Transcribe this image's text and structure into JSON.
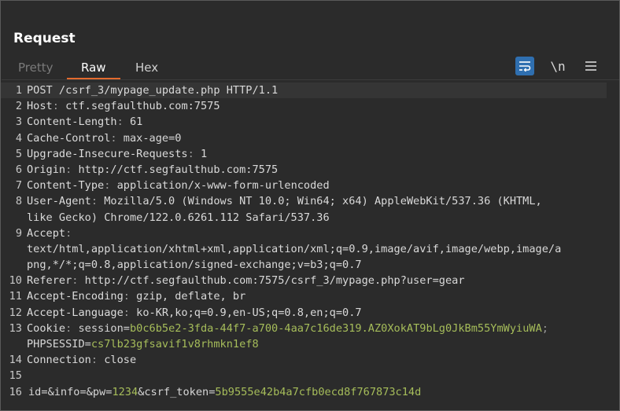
{
  "panel": {
    "title": "Request"
  },
  "tabs": [
    {
      "label": "Pretty"
    },
    {
      "label": "Raw"
    },
    {
      "label": "Hex"
    }
  ],
  "toolbar": {
    "wrap_icon": "wrap-text-icon",
    "newline_label": "\\n",
    "menu_icon": "hamburger-menu-icon",
    "wrap_color": "#2f6fb0"
  },
  "accent_color": "#e36a2e",
  "lines": [
    {
      "n": "1",
      "text": "POST /csrf_3/mypage_update.php HTTP/1.1"
    },
    {
      "n": "2",
      "key": "Host",
      "val": "ctf.segfaulthub.com:7575"
    },
    {
      "n": "3",
      "key": "Content-Length",
      "val": "61"
    },
    {
      "n": "4",
      "key": "Cache-Control",
      "val": "max-age=0"
    },
    {
      "n": "5",
      "key": "Upgrade-Insecure-Requests",
      "val": "1"
    },
    {
      "n": "6",
      "key": "Origin",
      "val": "http://ctf.segfaulthub.com:7575"
    },
    {
      "n": "7",
      "key": "Content-Type",
      "val": "application/x-www-form-urlencoded"
    },
    {
      "n": "8",
      "key": "User-Agent",
      "val": "Mozilla/5.0 (Windows NT 10.0; Win64; x64) AppleWebKit/537.36 (KHTML,",
      "cont": "like Gecko) Chrome/122.0.6261.112 Safari/537.36"
    },
    {
      "n": "9",
      "key": "Accept",
      "val": "",
      "cont": "text/html,application/xhtml+xml,application/xml;q=0.9,image/avif,image/webp,image/a",
      "cont2": "png,*/*;q=0.8,application/signed-exchange;v=b3;q=0.7"
    },
    {
      "n": "10",
      "key": "Referer",
      "val": "http://ctf.segfaulthub.com:7575/csrf_3/mypage.php?user=gear"
    },
    {
      "n": "11",
      "key": "Accept-Encoding",
      "val": "gzip, deflate, br"
    },
    {
      "n": "12",
      "key": "Accept-Language",
      "val": "ko-KR,ko;q=0.9,en-US;q=0.8,en;q=0.7"
    },
    {
      "n": "13",
      "key": "Cookie",
      "cookie1_name": "session",
      "cookie1_val": "b0c6b5e2-3fda-44f7-a700-4aa7c16de319.AZ0XokAT9bLg0JkBm55YmWyiuWA",
      "cookie2_name": "PHPSESSID",
      "cookie2_val": "cs7lb23gfsavif1v8rhmkn1ef8"
    },
    {
      "n": "14",
      "key": "Connection",
      "val": "close"
    },
    {
      "n": "15"
    },
    {
      "n": "16",
      "body": [
        {
          "name": "id",
          "value": ""
        },
        {
          "name": "info",
          "value": ""
        },
        {
          "name": "pw",
          "value": "1234"
        },
        {
          "name": "csrf_token",
          "value": "5b9555e42b4a7cfb0ecd8f767873c14d"
        }
      ]
    }
  ]
}
